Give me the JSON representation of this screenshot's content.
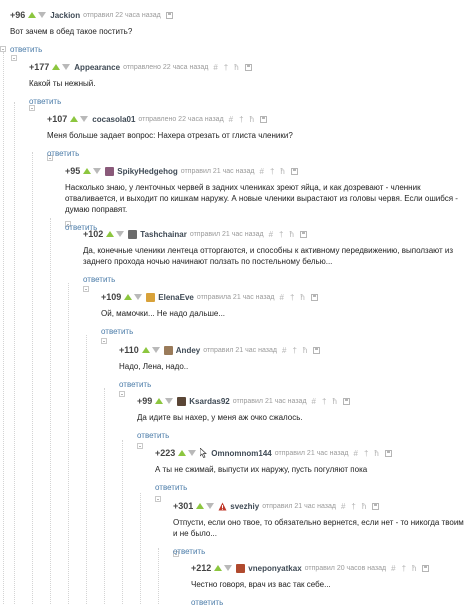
{
  "reply_label": "ответить",
  "icons": {
    "hash": "#",
    "pin": "†",
    "share": "ħ"
  },
  "comments": [
    {
      "rating": "+96",
      "author": "Jackion",
      "sent": "отправил 22 часа назад",
      "text": "Вот зачем в обед такое постить?",
      "avatar_color": ""
    },
    {
      "rating": "+177",
      "author": "Appearance",
      "sent": "отправлено 22 часа назад",
      "text": "Какой ты нежный.",
      "avatar_color": ""
    },
    {
      "rating": "+107",
      "author": "cocasola01",
      "sent": "отправлено 22 часа назад",
      "text": "Меня больше задает вопрос: Нахера отрезать от глиста членики?",
      "avatar_color": ""
    },
    {
      "rating": "+95",
      "author": "SpikyHedgehog",
      "sent": "отправил 21 час назад",
      "text": "Насколько знаю, у ленточных червей в задних члениках зреют яйца, и как дозревают - членник отваливается, и выходит по кишкам наружу. А новые членики вырастают из головы червя. Если ошибся - думаю поправят.",
      "avatar_color": "#8a5a7a"
    },
    {
      "rating": "+102",
      "author": "Tashchainar",
      "sent": "отправил 21 час назад",
      "text": "Да, конечные членики лентеца отторгаются, и способны к активному передвижению, выползают из заднего прохода ночью начинают ползать по постельному белью...",
      "avatar_color": "#6b6b6b"
    },
    {
      "rating": "+109",
      "author": "ElenaEve",
      "sent": "отправила 21 час назад",
      "text": "Ой, мамочки... Не надо дальше...",
      "avatar_color": "#d8a23a"
    },
    {
      "rating": "+110",
      "author": "Andey",
      "sent": "отправил 21 час назад",
      "text": "Надо, Лена, надо..",
      "avatar_color": "#9a7b5a"
    },
    {
      "rating": "+99",
      "author": "Ksardas92",
      "sent": "отправил 21 час назад",
      "text": "Да идите вы нахер, у меня аж очко сжалось.",
      "avatar_color": "#5a4636"
    },
    {
      "rating": "+223",
      "author": "Omnomnom144",
      "sent": "отправил 21 час назад",
      "text": "А ты не сжимай, выпусти их наружу, пусть погуляют пока",
      "avatar_color": ""
    },
    {
      "rating": "+301",
      "author": "svezhiy",
      "sent": "отправил 21 час назад",
      "text": "Отпусти, если оно твое, то обязательно вернется, если нет - то никогда твоим и не было...",
      "avatar_color": "#c0392b"
    },
    {
      "rating": "+212",
      "author": "vneponyatkax",
      "sent": "отправил 20 часов назад",
      "text": "Честно говоря, врач из вас так себе...",
      "avatar_color": "#b04a2e"
    }
  ]
}
